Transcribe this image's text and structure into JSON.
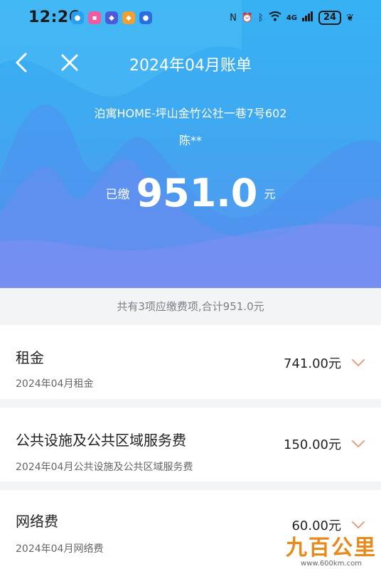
{
  "status_bar": {
    "time": "12:26",
    "network": "4G",
    "battery": "24"
  },
  "nav": {
    "title": "2024年04月账单"
  },
  "bill": {
    "address": "泊寓HOME-坪山金竹公社一巷7号602",
    "tenant": "陈**",
    "paid_label": "已缴",
    "paid_amount": "951.0",
    "paid_unit": "元",
    "summary": "共有3项应缴费项,合计951.0元",
    "items": [
      {
        "name": "租金",
        "desc": "2024年04月租金",
        "amount": "741.00元"
      },
      {
        "name": "公共设施及公共区域服务费",
        "desc": "2024年04月公共设施及公共区域服务费",
        "amount": "150.00元"
      },
      {
        "name": "网络费",
        "desc": "2024年04月网络费",
        "amount": "60.00元"
      }
    ]
  },
  "watermark": {
    "logo": "九百公里",
    "url": "www.600km.com"
  },
  "colors": {
    "hero_top": "#36b2f3",
    "hero_bottom": "#5b93ee",
    "chevron": "#e8a07a",
    "watermark": "#e8891c"
  }
}
